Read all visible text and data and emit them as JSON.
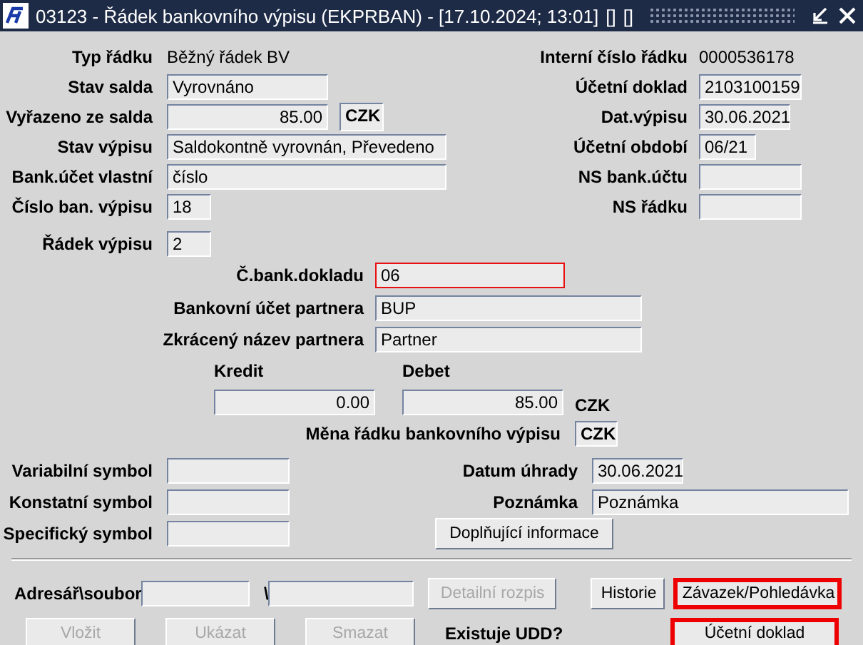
{
  "window": {
    "title": "03123 - Řádek bankovního výpisu (EKPRBAN) - [17.10.2024; 13:01]",
    "markers": [
      "[]",
      "[]"
    ]
  },
  "header_left": [
    {
      "label": "Typ řádku",
      "value": "Běžný řádek BV",
      "kind": "text"
    },
    {
      "label": "Stav salda",
      "value": "Vyrovnáno",
      "kind": "field"
    },
    {
      "label": "Vyřazeno ze salda",
      "value": "85.00",
      "kind": "amount",
      "currency": "CZK"
    },
    {
      "label": "Stav výpisu",
      "value": "Saldokontně vyrovnán, Převedeno",
      "kind": "field"
    },
    {
      "label": "Bank.účet vlastní",
      "value": "číslo",
      "kind": "field"
    },
    {
      "label": "Číslo ban. výpisu",
      "value": "18",
      "kind": "field"
    },
    {
      "label": "Řádek výpisu",
      "value": "2",
      "kind": "field"
    }
  ],
  "header_right": [
    {
      "label": "Interní číslo řádku",
      "value": "0000536178",
      "kind": "text"
    },
    {
      "label": "Účetní doklad",
      "value": "2103100159",
      "kind": "field"
    },
    {
      "label": "Dat.výpisu",
      "value": "30.06.2021",
      "kind": "field"
    },
    {
      "label": "Účetní období",
      "value": "06/21",
      "kind": "field"
    },
    {
      "label": "NS bank.účtu",
      "kind": "field"
    },
    {
      "label": "NS řádku",
      "kind": "field"
    }
  ],
  "partner": [
    {
      "label": "Č.bank.dokladu",
      "value": "06",
      "highlighted": true
    },
    {
      "label": "Bankovní účet partnera",
      "value": "BUP",
      "highlighted": false
    },
    {
      "label": "Zkrácený název partnera",
      "value": "Partner",
      "highlighted": false
    }
  ],
  "amounts": {
    "kredit": {
      "label": "Kredit",
      "value": "0.00"
    },
    "debet": {
      "label": "Debet",
      "value": "85.00"
    },
    "currency": "CZK",
    "line_currency": {
      "label": "Měna řádku bankovního výpisu",
      "value": "CZK"
    }
  },
  "symbols": [
    {
      "label": "Variabilní symbol"
    },
    {
      "label": "Konstatní symbol"
    },
    {
      "label": "Specifický symbol"
    }
  ],
  "payment": [
    {
      "label": "Datum úhrady",
      "value": "30.06.2021"
    },
    {
      "label": "Poznámka",
      "value": "Poznámka"
    }
  ],
  "info_button": {
    "label": "Doplňující informace",
    "disabled": false
  },
  "file": {
    "label": "Adresář\\soubor",
    "separator": "\\"
  },
  "file_buttons": [
    {
      "label": "Detailní rozpis",
      "disabled": true,
      "highlighted": false
    },
    {
      "label": "Historie",
      "disabled": false,
      "highlighted": false
    },
    {
      "label": "Závazek/Pohledávka",
      "disabled": false,
      "highlighted": true
    }
  ],
  "bottom_buttons": [
    {
      "label": "Vložit",
      "disabled": true,
      "highlighted": false
    },
    {
      "label": "Ukázat",
      "disabled": true,
      "highlighted": false
    },
    {
      "label": "Smazat",
      "disabled": true,
      "highlighted": false
    }
  ],
  "udd_label": "Existuje UDD?",
  "doc_button": {
    "label": "Účetní doklad",
    "disabled": false,
    "highlighted": true
  }
}
